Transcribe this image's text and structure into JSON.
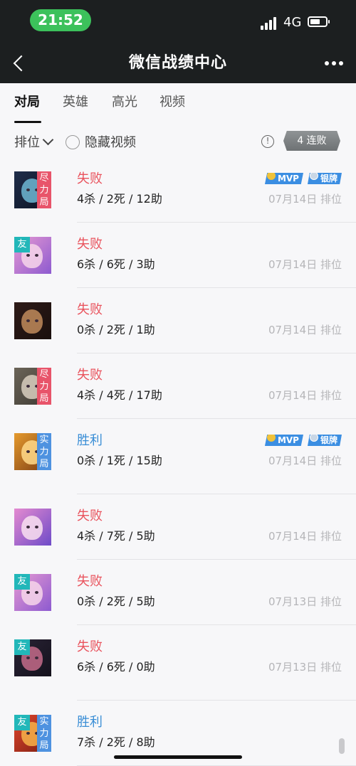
{
  "status": {
    "time": "21:52",
    "network": "4G"
  },
  "nav": {
    "title": "微信战绩中心"
  },
  "tabs": [
    "对局",
    "英雄",
    "高光",
    "视频"
  ],
  "filter": {
    "sort": "排位",
    "hide_video": "隐藏视频",
    "info": "!",
    "streak": "4 连败"
  },
  "matches": [
    {
      "result": "失败",
      "outcome": "lose",
      "kda": "4杀 / 2死 / 12助",
      "date": "07月14日",
      "mode": "排位",
      "friend": "",
      "tag": "尽力局",
      "badges": [
        "MVP",
        "银牌"
      ],
      "colors": [
        "#1f2d4a",
        "#6fb7d3",
        "#0d1424"
      ]
    },
    {
      "result": "失败",
      "outcome": "lose",
      "kda": "6杀 / 6死 / 3助",
      "date": "07月14日",
      "mode": "排位",
      "friend": "友",
      "tag": "",
      "badges": [],
      "colors": [
        "#e79ad2",
        "#f7d6ea",
        "#8d5ad0"
      ]
    },
    {
      "result": "失败",
      "outcome": "lose",
      "kda": "0杀 / 2死 / 1助",
      "date": "07月14日",
      "mode": "排位",
      "friend": "",
      "tag": "",
      "badges": [],
      "colors": [
        "#2e1b18",
        "#c18b5c",
        "#1a0f0d"
      ]
    },
    {
      "result": "失败",
      "outcome": "lose",
      "kda": "4杀 / 4死 / 17助",
      "date": "07月14日",
      "mode": "排位",
      "friend": "",
      "tag": "尽力局",
      "badges": [],
      "colors": [
        "#6b6458",
        "#d9cfbf",
        "#3e3a33"
      ]
    },
    {
      "result": "胜利",
      "outcome": "win",
      "kda": "0杀 / 1死 / 15助",
      "date": "07月14日",
      "mode": "排位",
      "friend": "",
      "tag": "实力局",
      "badges": [
        "MVP",
        "银牌"
      ],
      "colors": [
        "#e59a2e",
        "#ffd98a",
        "#7a3b12"
      ]
    },
    {
      "result": "失败",
      "outcome": "lose",
      "kda": "4杀 / 7死 / 5助",
      "date": "07月14日",
      "mode": "排位",
      "friend": "",
      "tag": "",
      "badges": [],
      "colors": [
        "#e48ad0",
        "#f9e0f0",
        "#6e4bc8"
      ]
    },
    {
      "result": "失败",
      "outcome": "lose",
      "kda": "0杀 / 2死 / 5助",
      "date": "07月13日",
      "mode": "排位",
      "friend": "友",
      "tag": "",
      "badges": [],
      "colors": [
        "#e79ad2",
        "#f7d6ea",
        "#8d5ad0"
      ]
    },
    {
      "result": "失败",
      "outcome": "lose",
      "kda": "6杀 / 6死 / 0助",
      "date": "07月13日",
      "mode": "排位",
      "friend": "友",
      "tag": "",
      "badges": [],
      "colors": [
        "#2a2436",
        "#c46b8a",
        "#14111c"
      ]
    },
    {
      "result": "胜利",
      "outcome": "win",
      "kda": "7杀 / 2死 / 8助",
      "date": "",
      "mode": "",
      "friend": "友",
      "tag": "实力局",
      "badges": [],
      "colors": [
        "#e2462d",
        "#f7b14a",
        "#7a1e12"
      ]
    }
  ]
}
